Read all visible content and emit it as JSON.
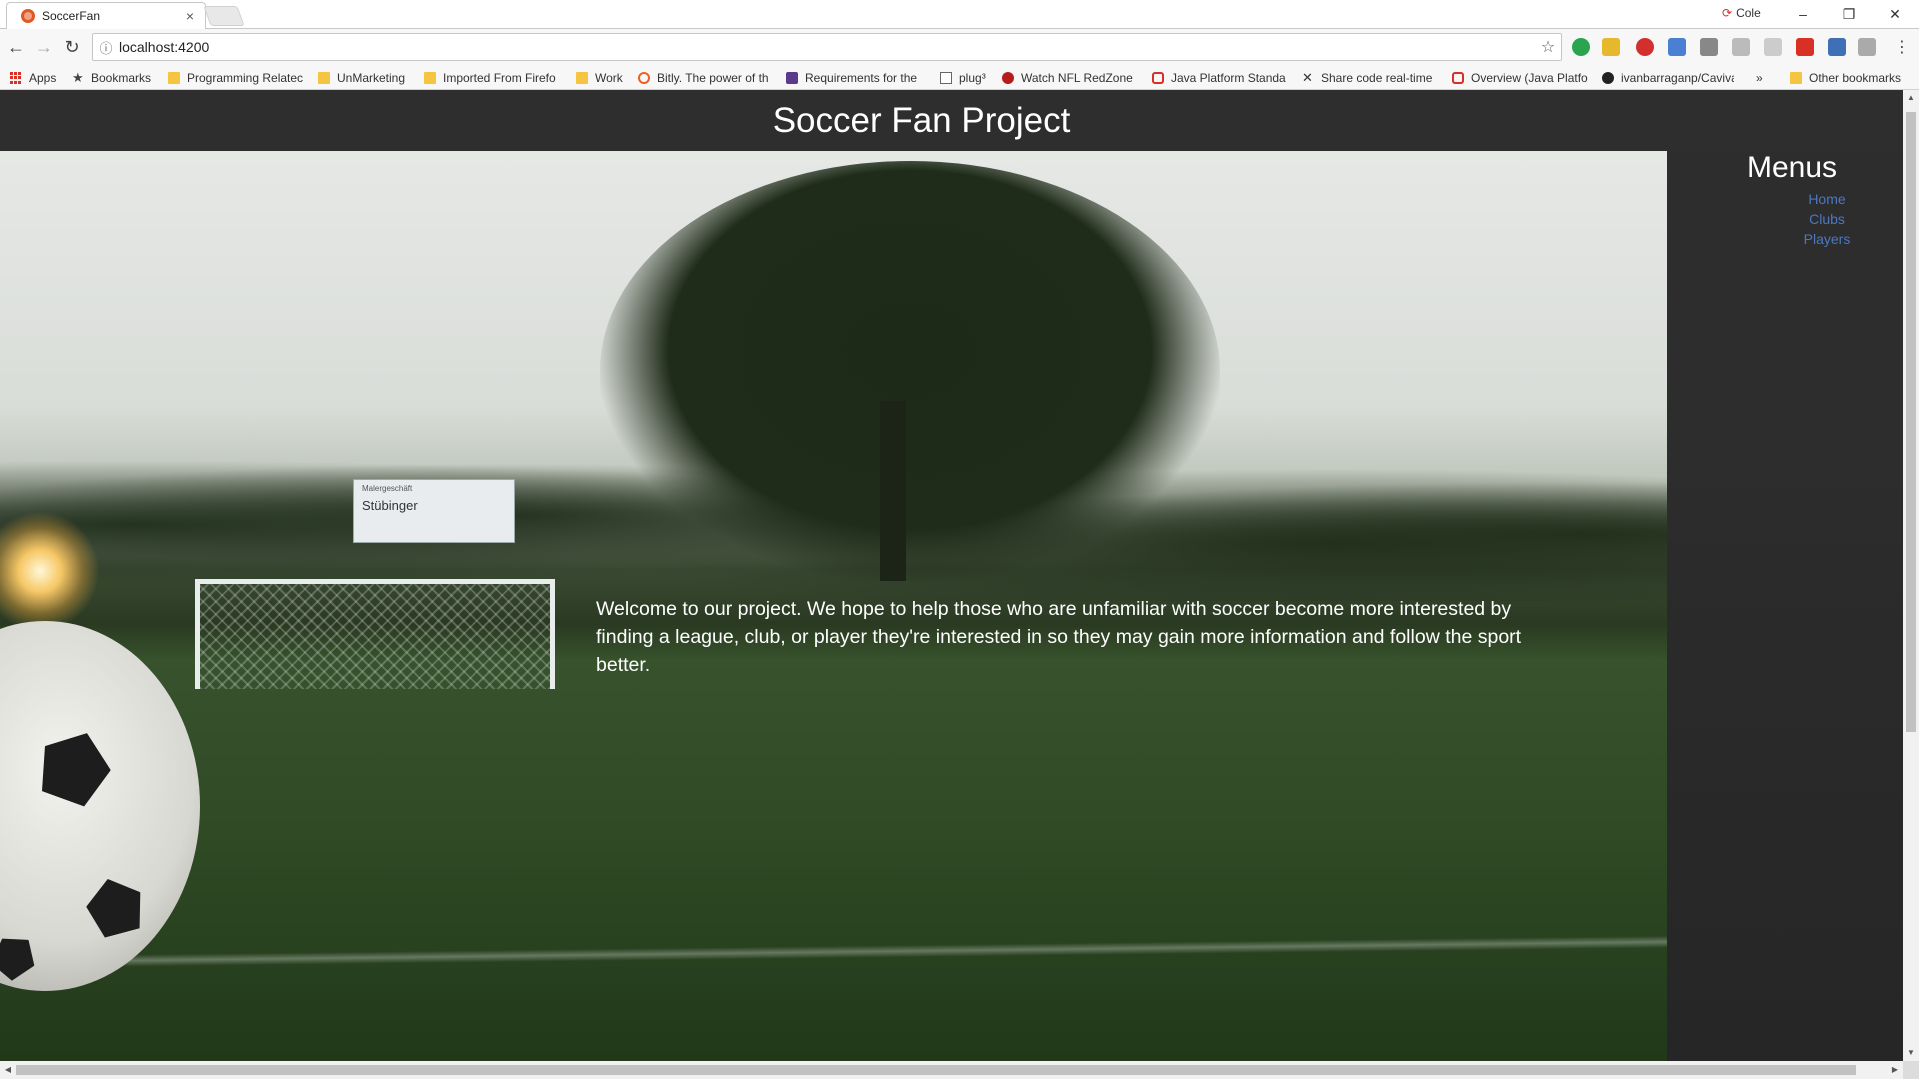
{
  "browser": {
    "tab_title": "SoccerFan",
    "tab_close": "×",
    "profile_name": "Cole",
    "window": {
      "minimize": "–",
      "restore": "❐",
      "close": "✕"
    },
    "url": "localhost:4200",
    "nav": {
      "back": "←",
      "forward": "→",
      "reload": "↻",
      "info": "ⓘ",
      "star": "☆",
      "more": "⋮"
    },
    "bookmarks": [
      {
        "label": "Apps",
        "icon": "apps-grid-icon"
      },
      {
        "label": "Bookmarks",
        "icon": "star-icon"
      },
      {
        "label": "Programming Relatec",
        "icon": "folder-icon"
      },
      {
        "label": "UnMarketing",
        "icon": "folder-icon"
      },
      {
        "label": "Imported From Firefo",
        "icon": "folder-icon"
      },
      {
        "label": "Work",
        "icon": "folder-icon"
      },
      {
        "label": "Bitly. The power of th",
        "icon": "bitly-icon"
      },
      {
        "label": "Requirements for the",
        "icon": "site-icon"
      },
      {
        "label": "plug³",
        "icon": "page-icon"
      },
      {
        "label": "Watch NFL RedZone",
        "icon": "redzone-icon"
      },
      {
        "label": "Java Platform Standa",
        "icon": "oracle-icon"
      },
      {
        "label": "Share code real-time",
        "icon": "share-code-icon"
      },
      {
        "label": "Overview (Java Platfo",
        "icon": "oracle-icon"
      },
      {
        "label": "ivanbarraganp/Caviva",
        "icon": "github-icon"
      }
    ],
    "bookmarks_overflow": "»",
    "other_bookmarks": "Other bookmarks",
    "colors": {
      "folder": "#f5c542",
      "oracle": "#d93025"
    }
  },
  "site": {
    "title": "Soccer Fan Project",
    "welcome": "Welcome to our project. We hope to help those who are unfamiliar with soccer become more interested by finding a league, club, or player they're interested in so they may gain more information and follow the sport better.",
    "sidebar": {
      "title": "Menus",
      "links": [
        "Home",
        "Clubs",
        "Players"
      ]
    },
    "hero_sign": {
      "small": "Malergeschäft",
      "big": "Stübinger"
    },
    "colors": {
      "header_bg": "#2e2e2e",
      "link": "#4a78c2",
      "text": "#ffffff"
    }
  }
}
